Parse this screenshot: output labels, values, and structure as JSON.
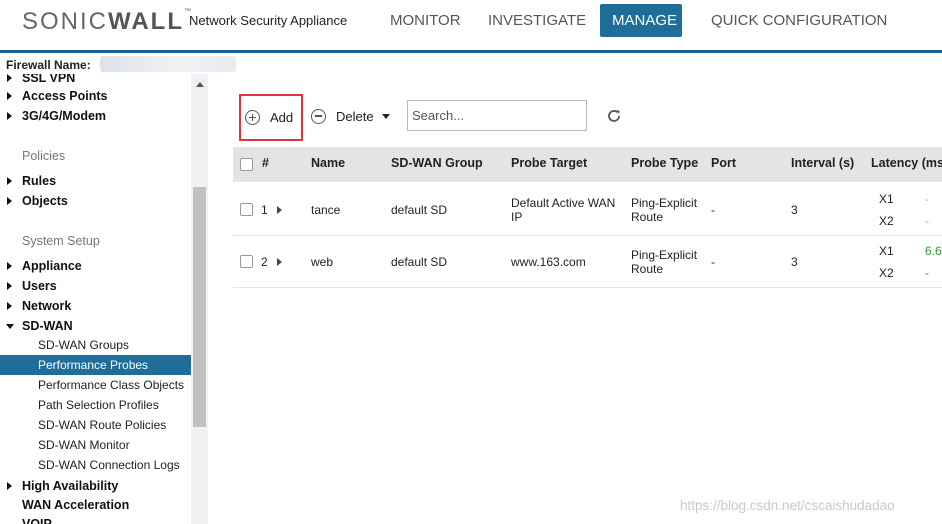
{
  "brand": {
    "logo_light": "SONIC",
    "logo_bold": "WALL",
    "product": "Network Security Appliance"
  },
  "nav": {
    "tabs": [
      "MONITOR",
      "INVESTIGATE",
      "MANAGE",
      "QUICK CONFIGURATION"
    ],
    "active": "MANAGE"
  },
  "sidebar": {
    "firewall_label": "Firewall Name:",
    "items": [
      "SSL VPN",
      "Access Points",
      "3G/4G/Modem"
    ],
    "policies_heading": "Policies",
    "policies": [
      "Rules",
      "Objects"
    ],
    "system_heading": "System Setup",
    "system": [
      "Appliance",
      "Users",
      "Network"
    ],
    "sdwan": "SD-WAN",
    "sdwan_children": [
      "SD-WAN Groups",
      "Performance Probes",
      "Performance Class Objects",
      "Path Selection Profiles",
      "SD-WAN Route Policies",
      "SD-WAN Monitor",
      "SD-WAN Connection Logs"
    ],
    "after": [
      "High Availability",
      "WAN Acceleration",
      "VOIP"
    ],
    "active_child": "Performance Probes"
  },
  "toolbar": {
    "add_label": "Add",
    "delete_label": "Delete",
    "search_placeholder": "Search..."
  },
  "table": {
    "headers": [
      "#",
      "Name",
      "SD-WAN Group",
      "Probe Target",
      "Probe Type",
      "Port",
      "Interval (s)",
      "Latency (ms)"
    ],
    "rows": [
      {
        "num": "1",
        "name": "tance",
        "group": "default SD",
        "target_l1": "Default Active WAN",
        "target_l2": "IP",
        "type_l1": "Ping-Explicit",
        "type_l2": "Route",
        "port": "-",
        "interval": "3",
        "iface1": "X1",
        "lat1": "-",
        "iface2": "X2",
        "lat2": "-"
      },
      {
        "num": "2",
        "name": "web",
        "group": "default SD",
        "target_l1": "www.163.com",
        "target_l2": "",
        "type_l1": "Ping-Explicit",
        "type_l2": "Route",
        "port": "-",
        "interval": "3",
        "iface1": "X1",
        "lat1": "6.6",
        "iface2": "X2",
        "lat2": "-"
      }
    ]
  },
  "watermark": "https://blog.csdn.net/cscaishudadao",
  "colors": {
    "accent": "#1f6e9a",
    "highlight_border": "#d9363e",
    "latency_orange": "#e8a33c",
    "latency_green": "#3a9a3a"
  }
}
